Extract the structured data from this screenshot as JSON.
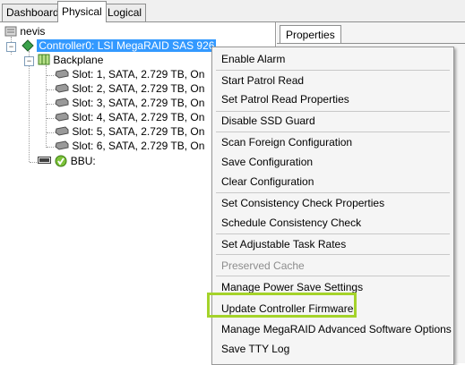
{
  "tabs": [
    {
      "label": "Dashboard"
    },
    {
      "label": "Physical"
    },
    {
      "label": "Logical"
    }
  ],
  "tree": {
    "root": "nevis",
    "controller": "Controller0: LSI MegaRAID SAS 926",
    "backplane": "Backplane",
    "slots": [
      "Slot: 1, SATA, 2.729 TB, On",
      "Slot: 2, SATA, 2.729 TB, On",
      "Slot: 3, SATA, 2.729 TB, On",
      "Slot: 4, SATA, 2.729 TB, On",
      "Slot: 5, SATA, 2.729 TB, On",
      "Slot: 6, SATA, 2.729 TB, On"
    ],
    "bbu": "BBU:"
  },
  "properties_tab": "Properties",
  "menu": {
    "items": [
      "Enable Alarm",
      "Start Patrol Read",
      "Set Patrol Read Properties",
      "Disable SSD Guard",
      "Scan Foreign Configuration",
      "Save Configuration",
      "Clear Configuration",
      "Set Consistency Check Properties",
      "Schedule Consistency Check",
      "Set Adjustable Task Rates",
      "Preserved Cache",
      "Manage Power Save Settings",
      "Update Controller Firmware",
      "Manage MegaRAID Advanced Software Options",
      "Save TTY Log"
    ],
    "disabled": [
      "Preserved Cache"
    ]
  },
  "colors": {
    "selection": "#3399ff",
    "highlight_box": "#a4d32a",
    "menu_bg": "#f5f5f5"
  }
}
